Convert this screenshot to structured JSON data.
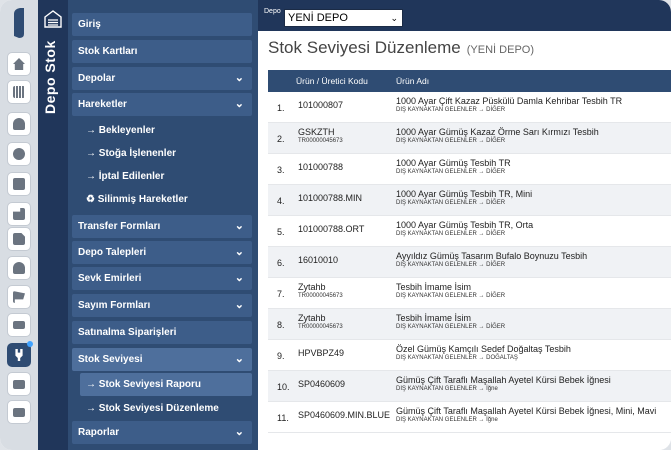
{
  "app": {
    "vertical_title": "Depo Stok",
    "colors": {
      "nav_dark": "#20365a",
      "nav": "#2f4c73",
      "menu_item": "#3d5d89",
      "menu_selected": "#4e6f9c",
      "accent_dot": "#3fa2ff"
    }
  },
  "rail": {
    "icons": [
      "home-icon",
      "barcode-icon",
      "user-icon",
      "gear-icon",
      "book-icon",
      "forklift-icon",
      "document-icon",
      "users-settings-icon",
      "cart-icon",
      "cash-icon",
      "plug-icon",
      "window-icon",
      "swap-icon"
    ]
  },
  "menu": {
    "items": [
      {
        "label": "Giriş"
      },
      {
        "label": "Stok Kartları"
      },
      {
        "label": "Depolar",
        "chevron": "⌄"
      },
      {
        "label": "Hareketler",
        "chevron": "⌄"
      },
      {
        "label": "→ Bekleyenler"
      },
      {
        "label": "→ Stoğa İşlenenler"
      },
      {
        "label": "→ İptal Edilenler"
      },
      {
        "label": "♻ Silinmiş Hareketler"
      },
      {
        "label": "Transfer Formları",
        "chevron": "⌄"
      },
      {
        "label": "Depo Talepleri",
        "chevron": "⌄"
      },
      {
        "label": "Sevk Emirleri",
        "chevron": "⌄"
      },
      {
        "label": "Sayım Formları",
        "chevron": "⌄"
      },
      {
        "label": "Satınalma Siparişleri"
      },
      {
        "label": "Stok Seviyesi",
        "chevron": "⌄"
      },
      {
        "label": "→ Stok Seviyesi Raporu"
      },
      {
        "label": "→ Stok Seviyesi Düzenleme"
      },
      {
        "label": "Raporlar",
        "chevron": "⌄"
      }
    ]
  },
  "depo": {
    "label": "Depo",
    "selected": "YENİ DEPO",
    "arrow": "⌄"
  },
  "page": {
    "title": "Stok Seviyesi Düzenleme",
    "subtitle": "(YENİ DEPO)"
  },
  "table": {
    "columns": [
      "Ürün / Üretici Kodu",
      "Ürün Adı"
    ],
    "rows": [
      {
        "n": "1.",
        "code": "101000807",
        "code2": "",
        "name": "1000 Ayar Çift Kazaz Püskülü Damla Kehribar Tesbih TR",
        "cat": "DIŞ KAYNAKTAN GELENLER → DİĞER"
      },
      {
        "n": "2.",
        "code": "GSKZTH",
        "code2": "TR00000045673",
        "name": "1000 Ayar Gümüş Kazaz Örme Sarı Kırmızı Tesbih",
        "cat": "DIŞ KAYNAKTAN GELENLER → DİĞER"
      },
      {
        "n": "3.",
        "code": "101000788",
        "code2": "",
        "name": "1000 Ayar Gümüş Tesbih TR",
        "cat": "DIŞ KAYNAKTAN GELENLER → DİĞER"
      },
      {
        "n": "4.",
        "code": "101000788.MIN",
        "code2": "",
        "name": "1000 Ayar Gümüş Tesbih TR, Mini",
        "cat": "DIŞ KAYNAKTAN GELENLER → DİĞER"
      },
      {
        "n": "5.",
        "code": "101000788.ORT",
        "code2": "",
        "name": "1000 Ayar Gümüş Tesbih TR, Orta",
        "cat": "DIŞ KAYNAKTAN GELENLER → DİĞER"
      },
      {
        "n": "6.",
        "code": "16010010",
        "code2": "",
        "name": "Ayyıldız Gümüş Tasarım Bufalo Boynuzu Tesbih",
        "cat": "DIŞ KAYNAKTAN GELENLER → DİĞER"
      },
      {
        "n": "7.",
        "code": "Zytahb",
        "code2": "TR00000045673",
        "name": "Tesbih İmame İsim",
        "cat": "DIŞ KAYNAKTAN GELENLER → DİĞER"
      },
      {
        "n": "8.",
        "code": "Zytahb",
        "code2": "TR00000045673",
        "name": "Tesbih İmame İsim",
        "cat": "DIŞ KAYNAKTAN GELENLER → DİĞER"
      },
      {
        "n": "9.",
        "code": "HPVBPZ49",
        "code2": "",
        "name": "Özel Gümüş Kamçılı Sedef Doğaltaş Tesbih",
        "cat": "DIŞ KAYNAKTAN GELENLER → DOĞALTAŞ"
      },
      {
        "n": "10.",
        "code": "SP0460609",
        "code2": "",
        "name": "Gümüş Çift Taraflı Maşallah Ayetel Kürsi Bebek İğnesi",
        "cat": "DIŞ KAYNAKTAN GELENLER → İğne"
      },
      {
        "n": "11.",
        "code": "SP0460609.MIN.BLUE",
        "code2": "",
        "name": "Gümüş Çift Taraflı Maşallah Ayetel Kürsi Bebek İğnesi, Mini, Mavi",
        "cat": "DIŞ KAYNAKTAN GELENLER → İğne"
      }
    ]
  }
}
